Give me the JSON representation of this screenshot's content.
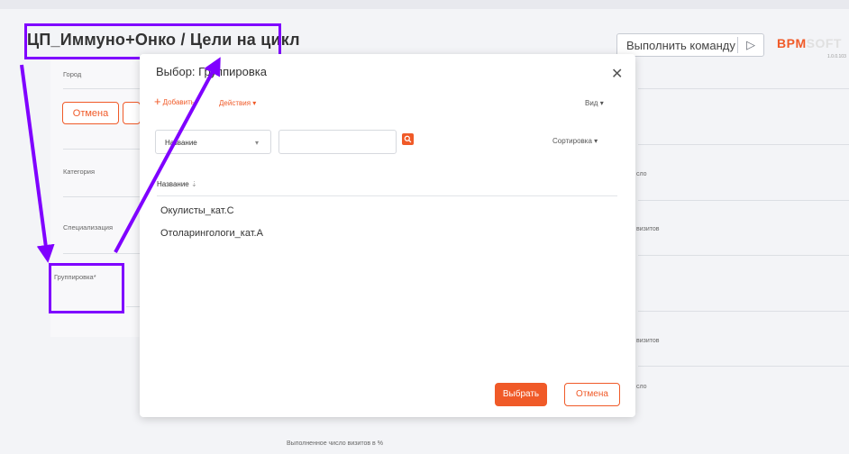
{
  "page": {
    "title": "ЦП_Иммуно+Онко / Цели на цикл",
    "command_label": "Выполнить команду",
    "logo_part1": "BPM",
    "logo_part2": "SOFT",
    "version": "1.0.0.103",
    "cancel_label": "Отмена"
  },
  "left_form": {
    "labels": [
      "Город",
      "Категория",
      "Специализация",
      "Группировка*"
    ]
  },
  "right_form": {
    "labels": [
      "сло",
      "визитов",
      "визитов",
      "сло"
    ]
  },
  "bottom": {
    "label": "Выполненное число визитов в %"
  },
  "dialog": {
    "title": "Выбор: Группировка",
    "toolbar": {
      "add_label": "Добавить",
      "actions_label": "Действия",
      "view_label": "Вид",
      "sort_label": "Сортировка"
    },
    "filter": {
      "field_label": "Название",
      "search_value": ""
    },
    "column_header": "Название",
    "rows": [
      "Окулисты_кат.С",
      "Отоларингологи_кат.А"
    ],
    "buttons": {
      "select_label": "Выбрать",
      "cancel_label": "Отмена"
    }
  },
  "colors": {
    "accent": "#f05a28",
    "annotation": "#7f00ff"
  }
}
